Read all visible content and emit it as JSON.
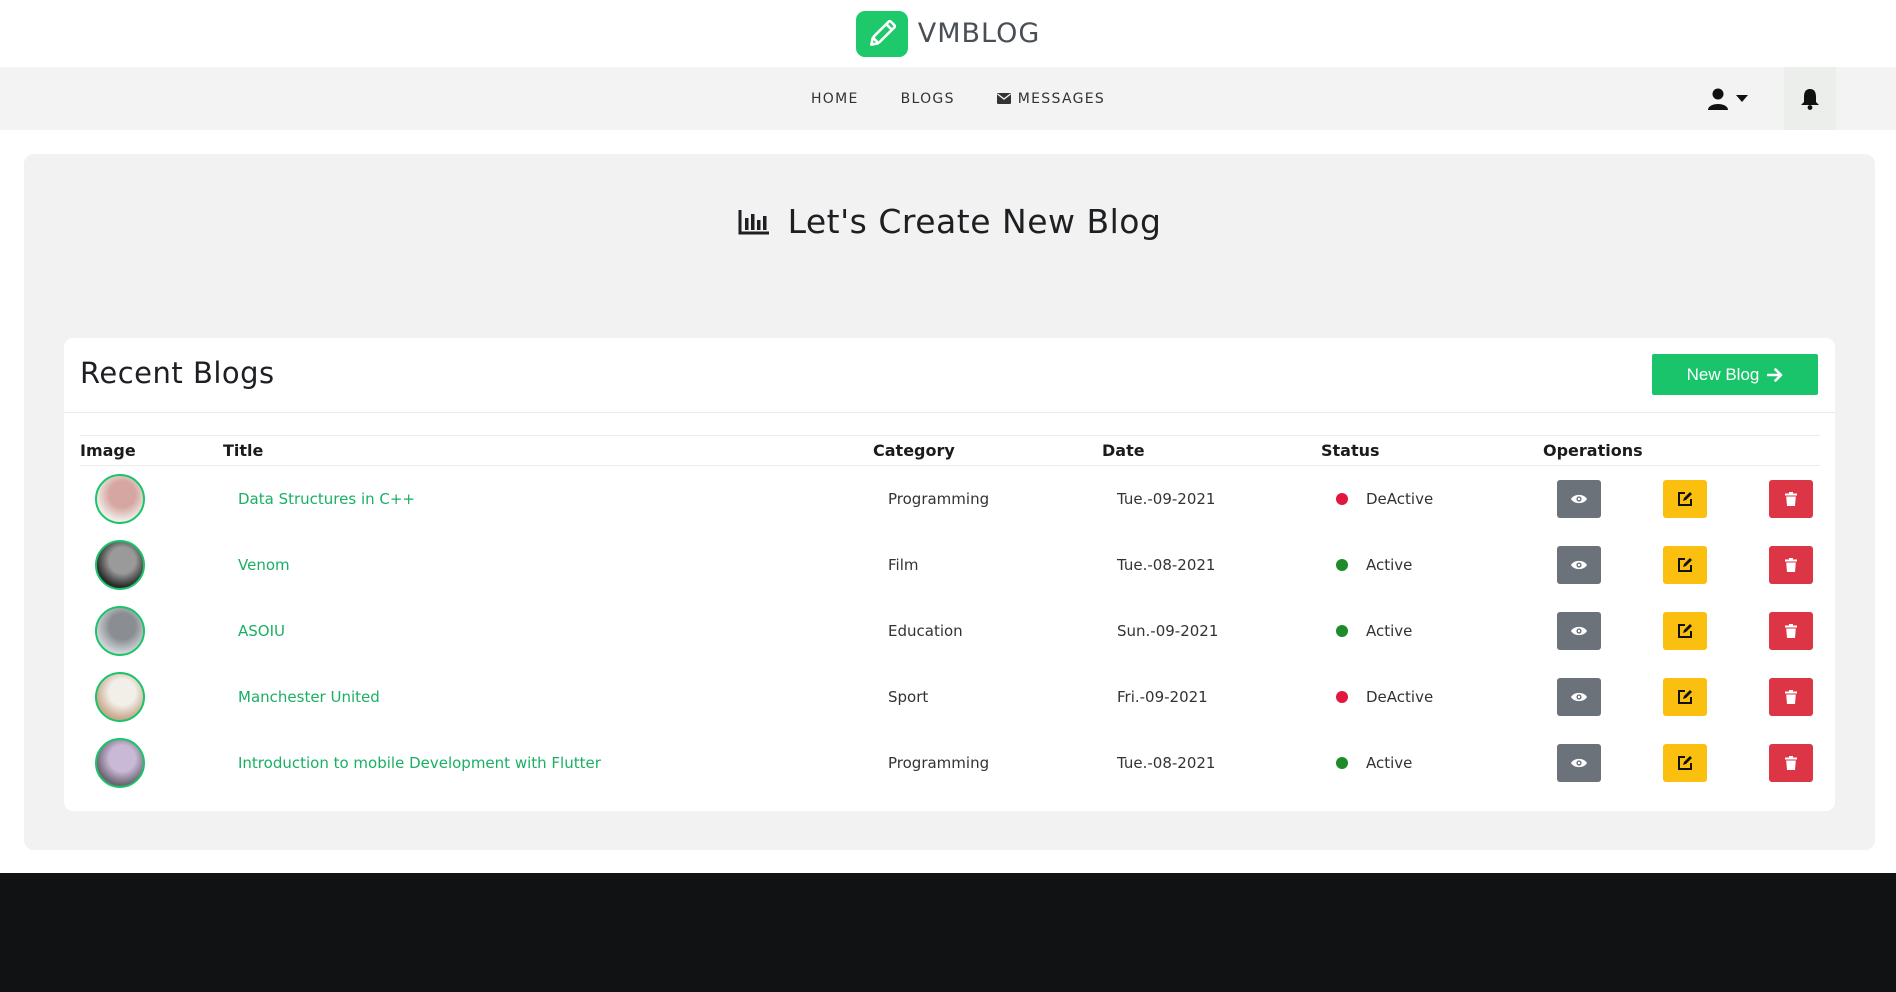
{
  "brand": {
    "name": "VMBLOG",
    "logo_icon": "pencil-icon",
    "accent": "#1ec96b"
  },
  "nav": {
    "items": [
      {
        "label": "HOME"
      },
      {
        "label": "BLOGS"
      },
      {
        "label": "MESSAGES",
        "icon": "envelope-icon"
      }
    ],
    "user_icon": "user-icon",
    "bell_icon": "bell-icon"
  },
  "hero": {
    "title": "Let's Create New Blog",
    "icon": "bar-chart-icon"
  },
  "card": {
    "title": "Recent Blogs",
    "new_blog_label": "New Blog",
    "columns": [
      "Image",
      "Title",
      "Category",
      "Date",
      "Status",
      "Operations"
    ],
    "rows": [
      {
        "title": "Data Structures in C++",
        "category": "Programming",
        "date": "Tue.-09-2021",
        "status": "DeActive",
        "status_color": "#e3173e"
      },
      {
        "title": "Venom",
        "category": "Film",
        "date": "Tue.-08-2021",
        "status": "Active",
        "status_color": "#1e8b2a"
      },
      {
        "title": "ASOIU",
        "category": "Education",
        "date": "Sun.-09-2021",
        "status": "Active",
        "status_color": "#1e8b2a"
      },
      {
        "title": "Manchester United",
        "category": "Sport",
        "date": "Fri.-09-2021",
        "status": "DeActive",
        "status_color": "#e3173e"
      },
      {
        "title": "Introduction to mobile Development with Flutter",
        "category": "Programming",
        "date": "Tue.-08-2021",
        "status": "Active",
        "status_color": "#1e8b2a"
      }
    ]
  },
  "colors": {
    "view": "#6b7279",
    "edit": "#fbbf0f",
    "delete": "#dc3545",
    "link": "#19b064",
    "footer": "#111214"
  }
}
